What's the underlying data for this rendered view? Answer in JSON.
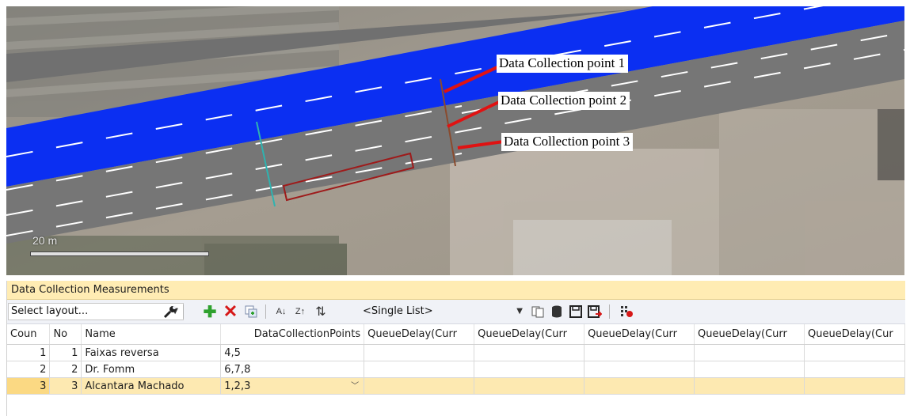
{
  "map": {
    "labels": [
      "Data Collection point 1",
      "Data Collection point 2",
      "Data Collection point 3"
    ],
    "scale_label": "20 m",
    "colors": {
      "road_gray": "#767676",
      "lane_blue": "#0a2ef0",
      "marker_red": "#e01212"
    }
  },
  "panel": {
    "title": "Data Collection Measurements",
    "toolbar": {
      "layout_select": "Select layout...",
      "list_select": "<Single List>",
      "icons": [
        "wrench-icon",
        "add-icon",
        "delete-icon",
        "duplicate-icon",
        "sort-ascending-icon",
        "sort-descending-icon",
        "clear-sort-icon",
        "copy-icon",
        "database-icon",
        "save-icon",
        "save-as-icon",
        "column-settings-icon"
      ]
    },
    "grid": {
      "headers": [
        "Coun",
        "No",
        "Name",
        "DataCollectionPoints",
        "QueueDelay(Curr",
        "QueueDelay(Curr",
        "QueueDelay(Curr",
        "QueueDelay(Curr",
        "QueueDelay(Cur"
      ],
      "rows": [
        {
          "count": "1",
          "no": "1",
          "name": "Faixas reversa",
          "points": "4,5"
        },
        {
          "count": "2",
          "no": "2",
          "name": "Dr. Fomm",
          "points": "6,7,8"
        },
        {
          "count": "3",
          "no": "3",
          "name": "Alcantara Machado",
          "points": "1,2,3"
        }
      ]
    }
  }
}
